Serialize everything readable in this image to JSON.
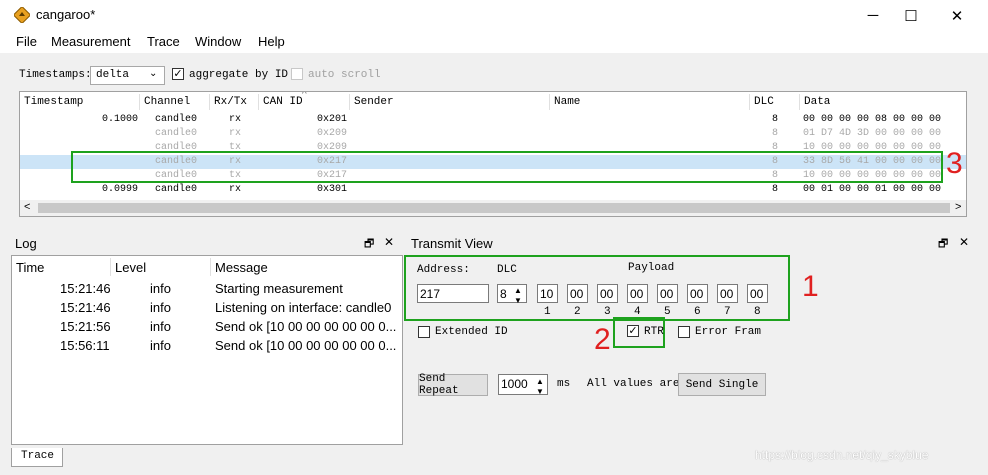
{
  "window": {
    "title": "cangaroo*",
    "minimize": "─",
    "maximize": "☐",
    "close": "✕"
  },
  "menu": [
    "File",
    "Measurement",
    "Trace",
    "Window",
    "Help"
  ],
  "toolbar": {
    "timestamps_label": "Timestamps:",
    "timestamps_value": "delta",
    "aggregate_label": "aggregate by ID",
    "aggregate_checked": true,
    "autoscroll_label": "auto scroll",
    "autoscroll_checked": false
  },
  "trace": {
    "columns": [
      "Timestamp",
      "Channel",
      "Rx/Tx",
      "CAN ID",
      "Sender",
      "Name",
      "DLC",
      "Data"
    ],
    "rows": [
      {
        "timestamp": "0.1000",
        "channel": "candle0",
        "rxtx": "rx",
        "canid": "0x201",
        "dlc": "8",
        "data": "00 00 00 00 08 00 00 00"
      },
      {
        "timestamp": "",
        "channel": "candle0",
        "rxtx": "rx",
        "canid": "0x209",
        "dlc": "8",
        "data": "01 D7 4D 3D 00 00 00 00"
      },
      {
        "timestamp": "",
        "channel": "candle0",
        "rxtx": "tx",
        "canid": "0x209",
        "dlc": "8",
        "data": "10 00 00 00 00 00 00 00"
      },
      {
        "timestamp": "",
        "channel": "candle0",
        "rxtx": "rx",
        "canid": "0x217",
        "dlc": "8",
        "data": "33 8D 56 41 00 00 00 00"
      },
      {
        "timestamp": "",
        "channel": "candle0",
        "rxtx": "tx",
        "canid": "0x217",
        "dlc": "8",
        "data": "10 00 00 00 00 00 00 00"
      },
      {
        "timestamp": "0.0999",
        "channel": "candle0",
        "rxtx": "rx",
        "canid": "0x301",
        "dlc": "8",
        "data": "00 01 00 00 01 00 00 00"
      }
    ]
  },
  "log": {
    "title": "Log",
    "columns": [
      "Time",
      "Level",
      "Message"
    ],
    "rows": [
      {
        "time": "15:21:46",
        "level": "info",
        "message": "Starting measurement"
      },
      {
        "time": "15:21:46",
        "level": "info",
        "message": "Listening on interface: candle0"
      },
      {
        "time": "15:21:56",
        "level": "info",
        "message": "Send ok [10 00 00 00 00 00 0..."
      },
      {
        "time": "15:56:11",
        "level": "info",
        "message": "Send ok [10 00 00 00 00 00 0..."
      }
    ]
  },
  "transmit": {
    "title": "Transmit View",
    "address_label": "Address:",
    "address_value": "217",
    "dlc_label": "DLC",
    "dlc_value": "8",
    "payload_label": "Payload",
    "payload": [
      "10",
      "00",
      "00",
      "00",
      "00",
      "00",
      "00",
      "00"
    ],
    "byte_indices": [
      "1",
      "2",
      "3",
      "4",
      "5",
      "6",
      "7",
      "8"
    ],
    "extended_label": "Extended ID",
    "rtr_label": "RTR",
    "rtr_checked": true,
    "error_label": "Error Fram",
    "send_repeat_label": "Send Repeat",
    "interval_value": "1000",
    "ms_label": "ms",
    "all_values_label": "All values are",
    "send_single_label": "Send Single"
  },
  "panel_icons": {
    "float": "🗗",
    "close": "✕"
  },
  "annotations": [
    "1",
    "2",
    "3"
  ],
  "bottom_tab": "Trace",
  "watermark": "https://blog.csdn.net/qiy_skyblue",
  "colors": {
    "annotation_box": "#1ea21e",
    "annotation_text": "#e02020",
    "selection": "#cce4f7"
  }
}
